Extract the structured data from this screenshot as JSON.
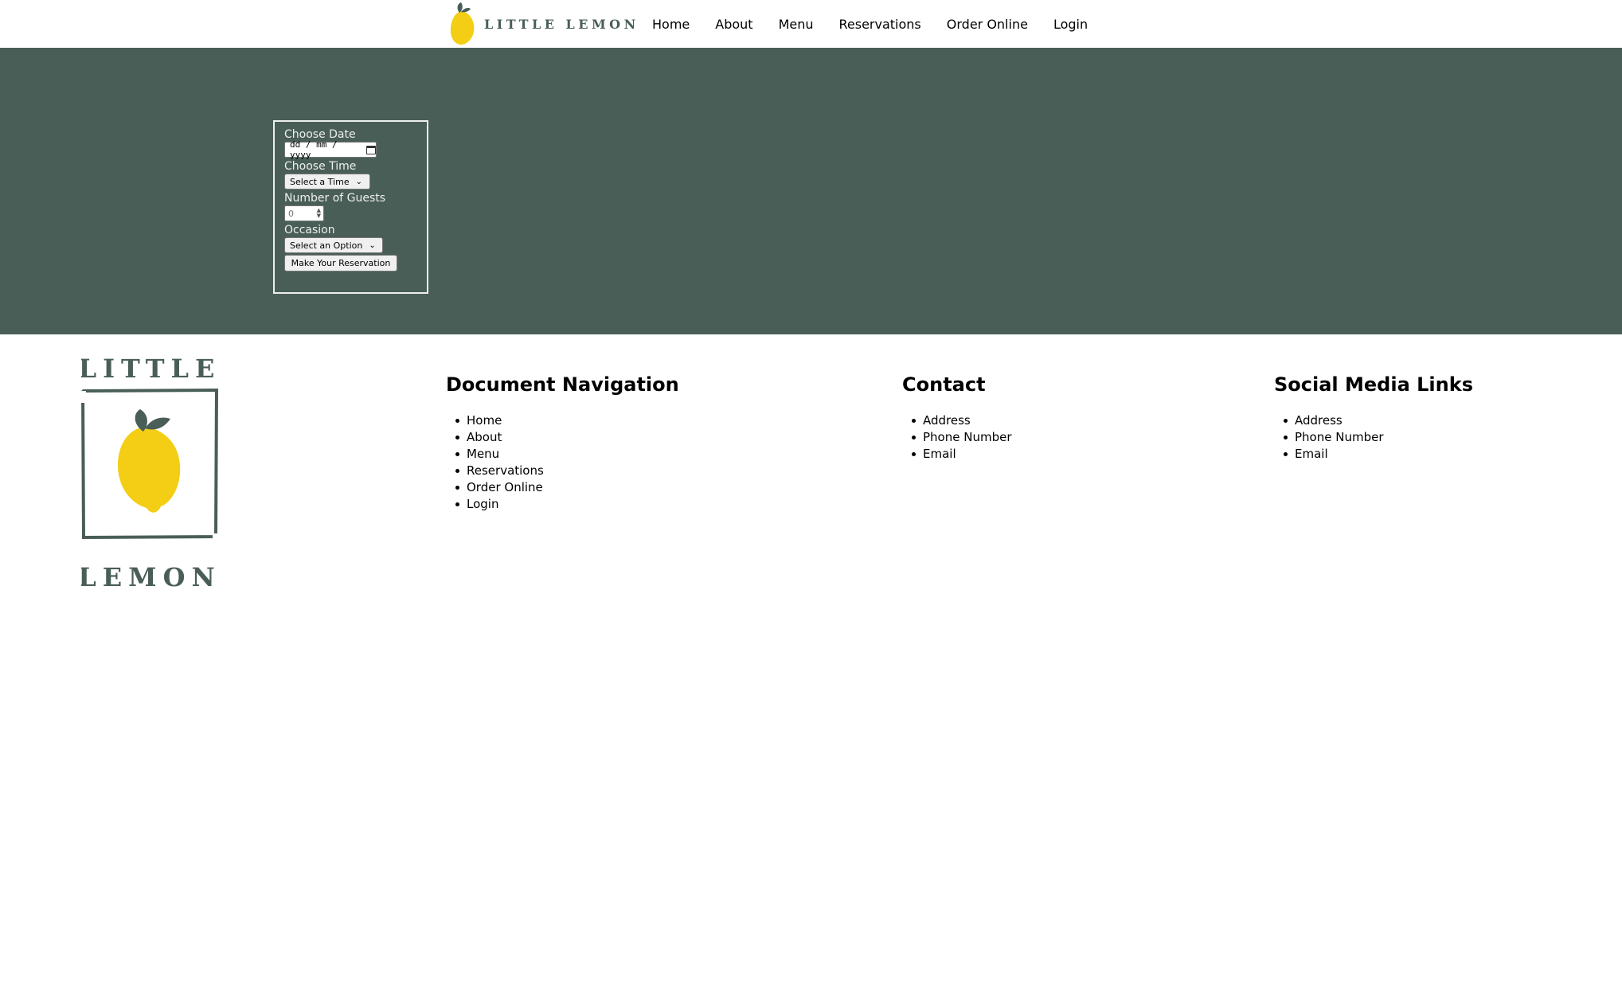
{
  "header": {
    "brand": "LITTLE LEMON",
    "nav": [
      "Home",
      "About",
      "Menu",
      "Reservations",
      "Order Online",
      "Login"
    ]
  },
  "reservation_form": {
    "date_label": "Choose Date",
    "date_placeholder": "dd / mm / yyyy",
    "time_label": "Choose Time",
    "time_value": "Select a Time",
    "guests_label": "Number of Guests",
    "guests_value": "0",
    "occasion_label": "Occasion",
    "occasion_value": "Select an Option",
    "submit_label": "Make Your Reservation"
  },
  "footer": {
    "logo_top": "LITTLE",
    "logo_bottom": "LEMON",
    "columns": [
      {
        "title": "Document Navigation",
        "items": [
          "Home",
          "About",
          "Menu",
          "Reservations",
          "Order Online",
          "Login"
        ]
      },
      {
        "title": "Contact",
        "items": [
          "Address",
          "Phone Number",
          "Email"
        ]
      },
      {
        "title": "Social Media Links",
        "items": [
          "Address",
          "Phone Number",
          "Email"
        ]
      }
    ]
  },
  "colors": {
    "primary_green": "#495e57",
    "lemon_yellow": "#f4ce14",
    "light_text": "#edefee"
  }
}
